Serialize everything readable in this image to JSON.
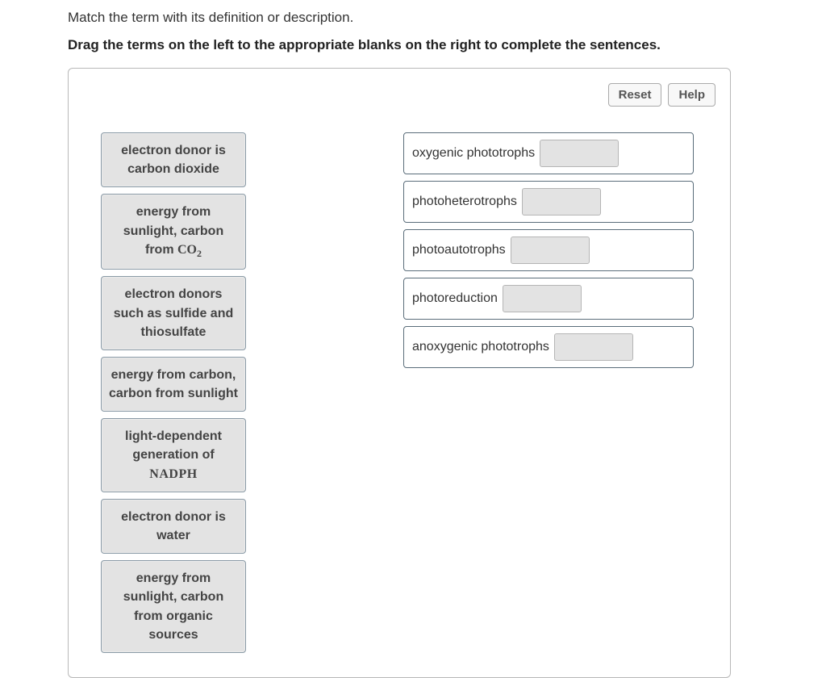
{
  "intro": "Match the term with its definition or description.",
  "instructions": "Drag the terms on the left to the appropriate blanks on the right to complete the sentences.",
  "toolbar": {
    "reset_label": "Reset",
    "help_label": "Help"
  },
  "terms": [
    {
      "text_pre": "electron donor is carbon dioxide"
    },
    {
      "text_pre": "energy from sunlight, carbon from ",
      "chem": "CO",
      "chem_sub": "2"
    },
    {
      "text_pre": "electron donors such as sulfide and thiosulfate"
    },
    {
      "text_pre": "energy from carbon, carbon from sunlight"
    },
    {
      "text_pre": "light-dependent generation of ",
      "nadph": "NADPH"
    },
    {
      "text_pre": "electron donor is water"
    },
    {
      "text_pre": "energy from sunlight, carbon from organic sources"
    }
  ],
  "targets": [
    {
      "label": "oxygenic phototrophs"
    },
    {
      "label": "photoheterotrophs"
    },
    {
      "label": "photoautotrophs"
    },
    {
      "label": "photoreduction"
    },
    {
      "label": "anoxygenic phototrophs"
    }
  ]
}
